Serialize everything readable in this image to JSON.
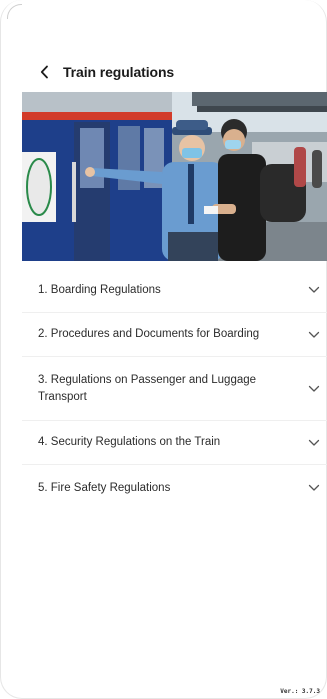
{
  "header": {
    "title": "Train regulations"
  },
  "hero": {
    "image_name": "train-platform-photo"
  },
  "sections": [
    {
      "label": "1. Boarding Regulations"
    },
    {
      "label": "2. Procedures and Documents for Boarding"
    },
    {
      "label": "3. Regulations on Passenger and Luggage Transport"
    },
    {
      "label": "4. Security Regulations on the Train"
    },
    {
      "label": "5. Fire Safety Regulations"
    }
  ],
  "footer": {
    "version": "Ver.: 3.7.3"
  },
  "colors": {
    "text": "#2c2c2c",
    "divider": "#efefef",
    "chevron": "#555555"
  }
}
